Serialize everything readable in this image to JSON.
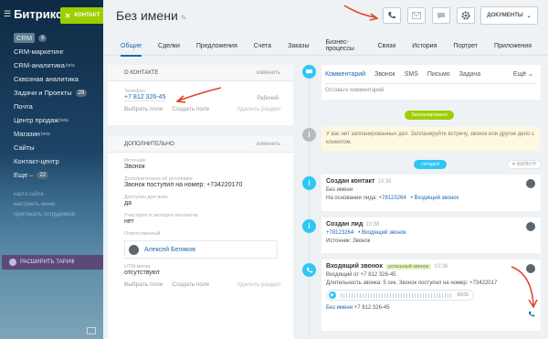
{
  "sidebar": {
    "logo": "Битрикс",
    "contact_button": "КОНТАКТ",
    "items": [
      {
        "label": "CRM",
        "badge": "6",
        "sup": ""
      },
      {
        "label": "CRM-маркетинг",
        "badge": "",
        "sup": ""
      },
      {
        "label": "CRM-аналитика",
        "badge": "",
        "sup": "beta"
      },
      {
        "label": "Сквозная аналитика",
        "badge": "",
        "sup": ""
      },
      {
        "label": "Задачи и Проекты",
        "badge": "29",
        "sup": ""
      },
      {
        "label": "Почта",
        "badge": "",
        "sup": ""
      },
      {
        "label": "Центр продаж",
        "badge": "",
        "sup": "beta"
      },
      {
        "label": "Магазин",
        "badge": "",
        "sup": "beta"
      },
      {
        "label": "Сайты",
        "badge": "",
        "sup": ""
      },
      {
        "label": "Контакт-центр",
        "badge": "",
        "sup": ""
      },
      {
        "label": "Еще",
        "badge": "22",
        "sup": ""
      }
    ],
    "faded_items": [
      "карта сайта",
      "настроить меню",
      "пригласить сотрудников"
    ],
    "extend_label": "РАСШИРИТЬ ТАРИФ"
  },
  "header": {
    "title": "Без имени",
    "documents_button": "ДОКУМЕНТЫ"
  },
  "tabs": [
    "Общие",
    "Сделки",
    "Предложения",
    "Счета",
    "Заказы",
    "Бизнес-процессы",
    "Связи",
    "История",
    "Портрет",
    "Приложения"
  ],
  "about": {
    "title": "О КОНТАКТЕ",
    "edit": "изменить",
    "phone_label": "Телефон",
    "phone_value": "+7 812 326-45",
    "phone_type": "Рабочий",
    "select_field": "Выбрать поле",
    "create_field": "Создать поле",
    "delete_section": "Удалить раздел"
  },
  "extra": {
    "title": "ДОПОЛНИТЕЛЬНО",
    "edit": "изменить",
    "source_label": "Источник",
    "source_value": "Звонок",
    "source_info_label": "Дополнительно об источнике",
    "source_info_value": "Звонок поступил на номер: +734220170",
    "public_label": "Доступен для всех",
    "public_value": "да",
    "export_label": "Участвует в экспорте контактов",
    "export_value": "нет",
    "responsible_label": "Ответственный",
    "responsible_value": "Алексей Беляков",
    "utm_label": "UTM-метки",
    "utm_value": "отсутствуют",
    "select_field": "Выбрать поле",
    "create_field": "Создать поле",
    "delete_section": "Удалить раздел"
  },
  "activity": {
    "tabs": [
      "Комментарий",
      "Звонок",
      "SMS",
      "Письмо",
      "Задача"
    ],
    "more": "Ещё",
    "comment_placeholder": "Оставьте комментарий",
    "planned_label": "Запланировано",
    "planned_text": "У вас нет запланированных дел. Запланируйте встречу, звонок или другое дело с клиентом.",
    "today_label": "сегодня",
    "filter_label": "ФИЛЬТР"
  },
  "events": {
    "contact": {
      "title": "Создан контакт",
      "time": "10:38",
      "line1": "Без имени",
      "line2_prefix": "На основании лида:",
      "line2_link": "+78123264",
      "line2_suffix": "Входящий звонок"
    },
    "lead": {
      "title": "Создан лид",
      "time": "10:38",
      "line1_link": "+78123264",
      "line1_suffix": "Входящий звонок",
      "line2": "Источник: Звонок"
    },
    "call": {
      "title": "Входящий звонок",
      "badge": "успешный звонок",
      "time": "10:38",
      "line1": "Входящий от +7 812 326-45",
      "line2": "Длительность звонка: 5 сек. Звонок поступил на номер: +73422017",
      "audio_time": "00:05",
      "footer_link": "Без имени",
      "footer_phone": "+7 812 326-45"
    }
  },
  "colors": {
    "accent": "#2067b0",
    "green": "#9dcf00",
    "timeline_blue": "#2fc6f6",
    "arrow": "#e0412b"
  }
}
